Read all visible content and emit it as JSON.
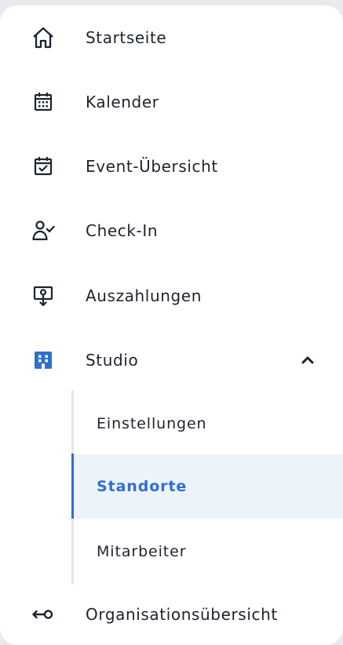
{
  "colors": {
    "background": "#e9eaed",
    "panel": "#ffffff",
    "text": "#1d2330",
    "accent": "#2f6fd1",
    "active_background": "#edf3fb"
  },
  "nav": {
    "items": [
      {
        "label": "Startseite",
        "icon": "home-icon"
      },
      {
        "label": "Kalender",
        "icon": "calendar-icon"
      },
      {
        "label": "Event-Übersicht",
        "icon": "calendar-check-icon"
      },
      {
        "label": "Check-In",
        "icon": "user-check-icon"
      },
      {
        "label": "Auszahlungen",
        "icon": "payout-icon"
      },
      {
        "label": "Studio",
        "icon": "building-icon",
        "expanded": true
      }
    ],
    "studio_sub_items": [
      {
        "label": "Einstellungen",
        "active": false
      },
      {
        "label": "Standorte",
        "active": true
      },
      {
        "label": "Mitarbeiter",
        "active": false
      }
    ],
    "footer_item": {
      "label": "Organisationsübersicht",
      "icon": "switch-organization-icon"
    }
  }
}
